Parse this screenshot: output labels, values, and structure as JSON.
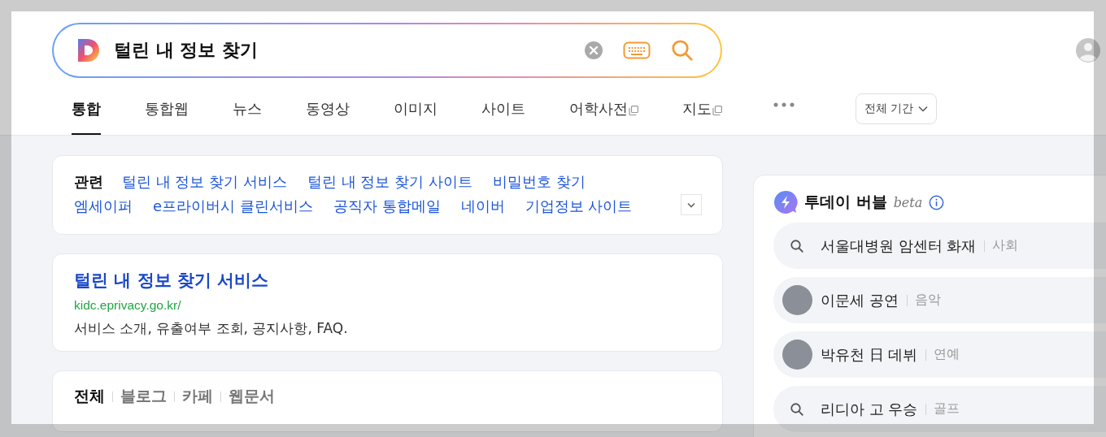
{
  "search": {
    "query": "털린 내 정보 찾기"
  },
  "tabs": [
    {
      "label": "통합",
      "selected": true,
      "external": false
    },
    {
      "label": "통합웹",
      "selected": false,
      "external": false
    },
    {
      "label": "뉴스",
      "selected": false,
      "external": false
    },
    {
      "label": "동영상",
      "selected": false,
      "external": false
    },
    {
      "label": "이미지",
      "selected": false,
      "external": false
    },
    {
      "label": "사이트",
      "selected": false,
      "external": false
    },
    {
      "label": "어학사전",
      "selected": false,
      "external": true
    },
    {
      "label": "지도",
      "selected": false,
      "external": true
    }
  ],
  "date_filter": "전체 기간",
  "related": {
    "label": "관련",
    "links": [
      "털린 내 정보 찾기 서비스",
      "털린 내 정보 찾기 사이트",
      "비밀번호 찾기",
      "엠세이퍼",
      "e프라이버시 클린서비스",
      "공직자 통합메일",
      "네이버",
      "기업정보 사이트"
    ]
  },
  "result": {
    "title": "털린 내 정보 찾기 서비스",
    "url": "kidc.eprivacy.go.kr/",
    "description": "서비스 소개, 유출여부 조회, 공지사항, FAQ."
  },
  "source_tabs": [
    {
      "label": "전체",
      "selected": true
    },
    {
      "label": "블로그",
      "selected": false
    },
    {
      "label": "카페",
      "selected": false
    },
    {
      "label": "웹문서",
      "selected": false
    }
  ],
  "today_bubble": {
    "title": "투데이 버블",
    "badge": "beta",
    "items": [
      {
        "kind": "search",
        "text": "서울대병원 암센터 화재",
        "category": "사회"
      },
      {
        "kind": "avatar",
        "text": "이문세 공연",
        "category": "음악"
      },
      {
        "kind": "avatar",
        "text": "박유천 日 데뷔",
        "category": "연예"
      },
      {
        "kind": "search",
        "text": "리디아 고 우승",
        "category": "골프"
      }
    ]
  }
}
